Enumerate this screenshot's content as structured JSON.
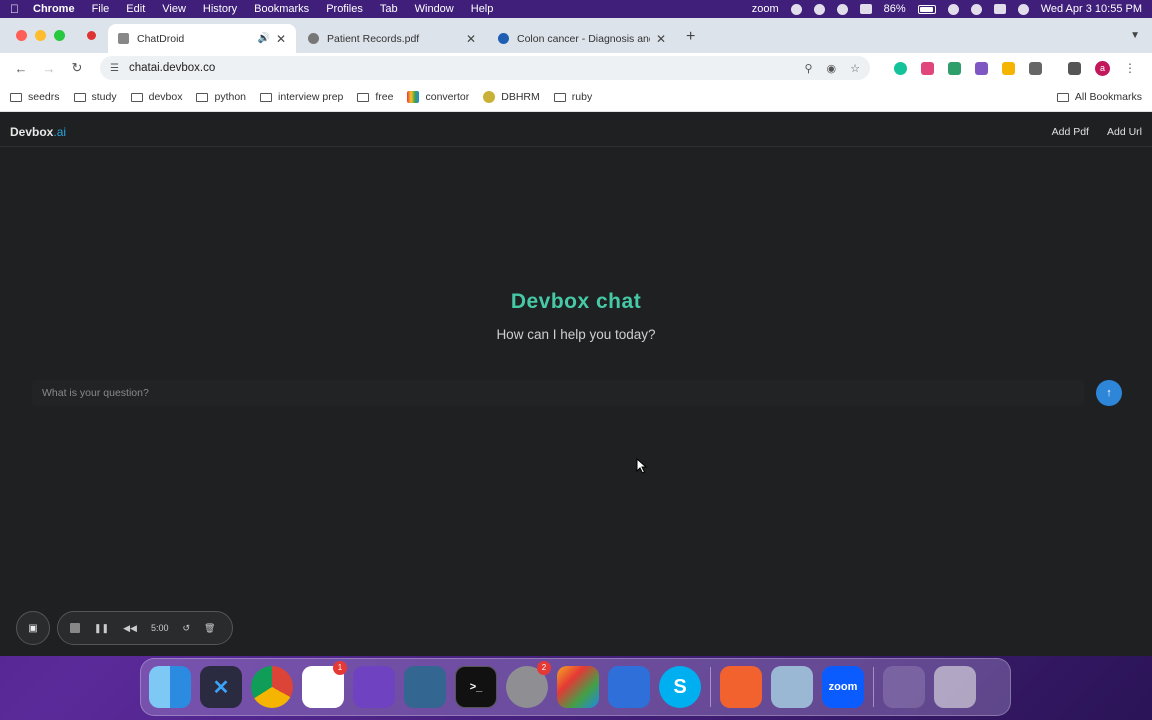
{
  "menubar": {
    "app_name": "Chrome",
    "items": [
      "File",
      "Edit",
      "View",
      "History",
      "Bookmarks",
      "Profiles",
      "Tab",
      "Window",
      "Help"
    ],
    "zoom_label": "zoom",
    "battery": "86%",
    "datetime": "Wed Apr 3  10:55 PM"
  },
  "tabs": [
    {
      "title": "ChatDroid",
      "active": true
    },
    {
      "title": "Patient Records.pdf",
      "active": false
    },
    {
      "title": "Colon cancer - Diagnosis and",
      "active": false
    }
  ],
  "toolbar": {
    "url": "chatai.devbox.co"
  },
  "bookmarks": {
    "items": [
      "seedrs",
      "study",
      "devbox",
      "python",
      "interview prep",
      "free",
      "convertor",
      "DBHRM",
      "ruby"
    ],
    "all_label": "All Bookmarks"
  },
  "app": {
    "brand_main": "Devbox",
    "brand_suffix": ".ai",
    "add_pdf": "Add Pdf",
    "add_url": "Add Url",
    "title": "Devbox chat",
    "subtitle": "How can I help you today?",
    "question_placeholder": "What is your question?"
  },
  "recorder": {
    "timer": "5:00"
  },
  "dock": {
    "slack_badge": "1",
    "settings_badge": "2",
    "zoom_label": "zoom"
  }
}
